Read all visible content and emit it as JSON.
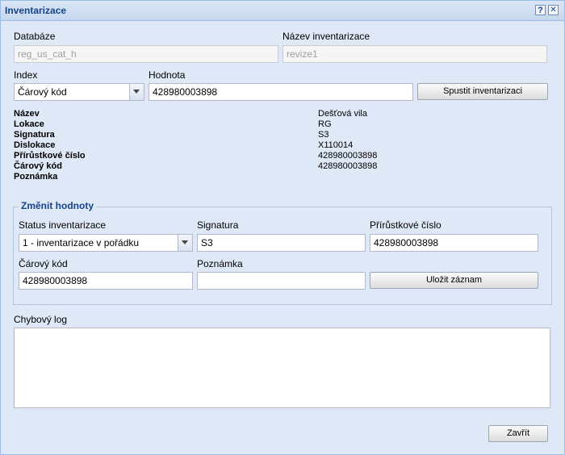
{
  "window": {
    "title": "Inventarizace",
    "help_label": "?",
    "close_label": "✕"
  },
  "database": {
    "label": "Databáze",
    "value": "reg_us_cat_h"
  },
  "inventory_name": {
    "label": "Název inventarizace",
    "value": "revize1"
  },
  "index": {
    "label": "Index",
    "value": "Čárový kód"
  },
  "hodnota": {
    "label": "Hodnota",
    "value": "428980003898"
  },
  "start_button": "Spustit inventarizaci",
  "info": [
    {
      "key": "Název",
      "value": "Dešťová vila"
    },
    {
      "key": "Lokace",
      "value": "RG"
    },
    {
      "key": "Signatura",
      "value": "S3"
    },
    {
      "key": "Dislokace",
      "value": "X110014"
    },
    {
      "key": "Přírůstkové číslo",
      "value": "428980003898"
    },
    {
      "key": "Čárový kód",
      "value": "428980003898"
    },
    {
      "key": "Poznámka",
      "value": ""
    }
  ],
  "change": {
    "legend": "Změnit hodnoty",
    "status_label": "Status inventarizace",
    "status_value": "1 - inventarizace v pořádku",
    "signatura_label": "Signatura",
    "signatura_value": "S3",
    "prirustkove_label": "Přírůstkové číslo",
    "prirustkove_value": "428980003898",
    "carovy_label": "Čárový kód",
    "carovy_value": "428980003898",
    "poznamka_label": "Poznámka",
    "poznamka_value": "",
    "save_button": "Uložit záznam"
  },
  "error_log": {
    "label": "Chybový log",
    "value": ""
  },
  "close_button": "Zavřít"
}
